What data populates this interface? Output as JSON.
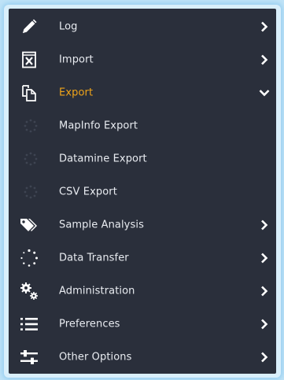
{
  "menu": {
    "items": [
      {
        "label": "Log",
        "icon": "pencil-icon",
        "expanded": false
      },
      {
        "label": "Import",
        "icon": "excel-import-icon",
        "expanded": false
      },
      {
        "label": "Export",
        "icon": "copy-export-icon",
        "expanded": true,
        "active": true,
        "children": [
          {
            "label": "MapInfo Export",
            "icon": "dotted-circle-icon"
          },
          {
            "label": "Datamine Export",
            "icon": "dotted-circle-icon"
          },
          {
            "label": "CSV Export",
            "icon": "dotted-circle-icon"
          }
        ]
      },
      {
        "label": "Sample Analysis",
        "icon": "tags-icon",
        "expanded": false
      },
      {
        "label": "Data Transfer",
        "icon": "spinner-icon",
        "expanded": false
      },
      {
        "label": "Administration",
        "icon": "cogs-icon",
        "expanded": false
      },
      {
        "label": "Preferences",
        "icon": "list-icon",
        "expanded": false
      },
      {
        "label": "Other Options",
        "icon": "sliders-icon",
        "expanded": false
      }
    ]
  },
  "colors": {
    "menu_background": "#2a2f3b",
    "text": "#e9ecf1",
    "active": "#f0a419",
    "frame_glow": "#bfe3f7"
  }
}
